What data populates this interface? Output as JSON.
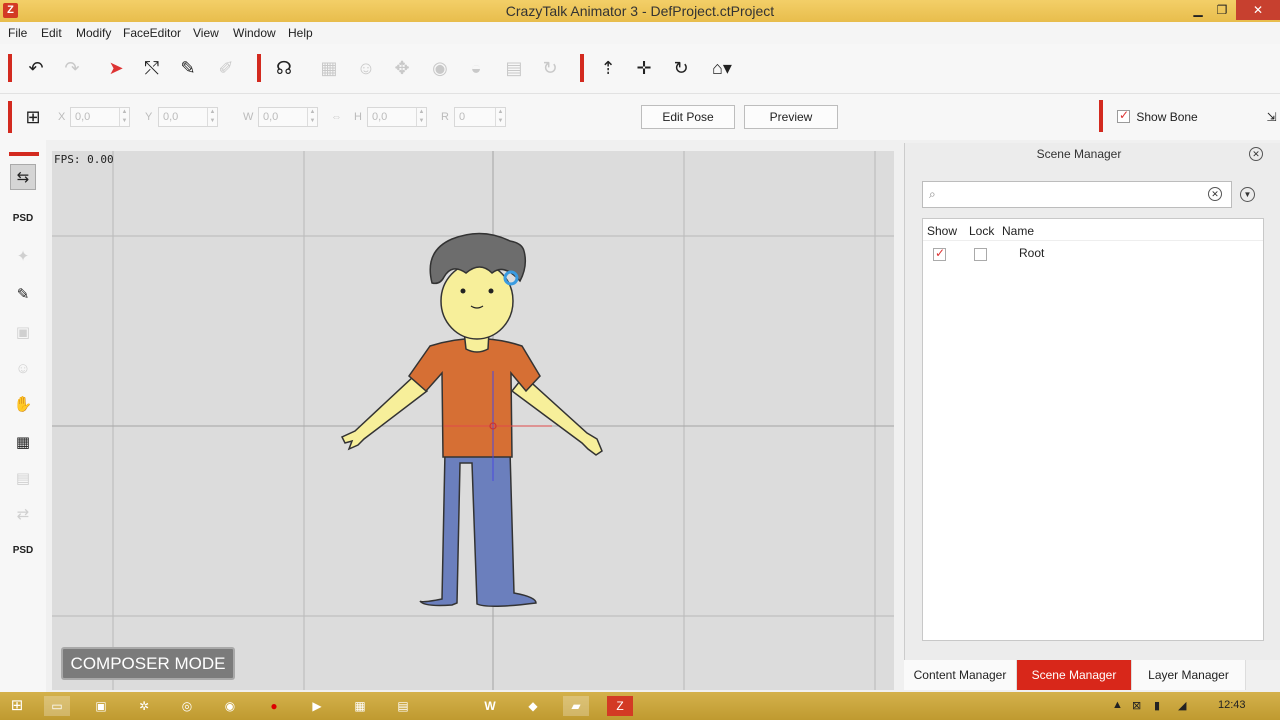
{
  "window": {
    "title": "CrazyTalk Animator 3  -  DefProject.ctProject",
    "app_icon": "Z"
  },
  "menu": [
    "File",
    "Edit",
    "Modify",
    "FaceEditor",
    "View",
    "Window",
    "Help"
  ],
  "props": {
    "x_label": "X",
    "x_value": "0,0",
    "y_label": "Y",
    "y_value": "0,0",
    "w_label": "W",
    "w_value": "0,0",
    "h_label": "H",
    "h_value": "0,0",
    "r_label": "R",
    "r_value": "0",
    "edit_pose": "Edit Pose",
    "preview": "Preview",
    "show_bone": "Show Bone"
  },
  "stage": {
    "fps": "FPS: 0.00",
    "mode": "COMPOSER MODE"
  },
  "scene_manager": {
    "title": "Scene Manager",
    "search_placeholder": "",
    "columns": [
      "Show",
      "Lock",
      "Name"
    ],
    "rows": [
      {
        "show": true,
        "lock": false,
        "name": "Root"
      }
    ]
  },
  "tabs": [
    "Content Manager",
    "Scene Manager",
    "Layer Manager"
  ],
  "taskbar": {
    "clock": "12:43"
  },
  "colors": {
    "accent": "#d8271a",
    "titlebar": "#e8bd4c",
    "stage": "#dcdcdc"
  }
}
